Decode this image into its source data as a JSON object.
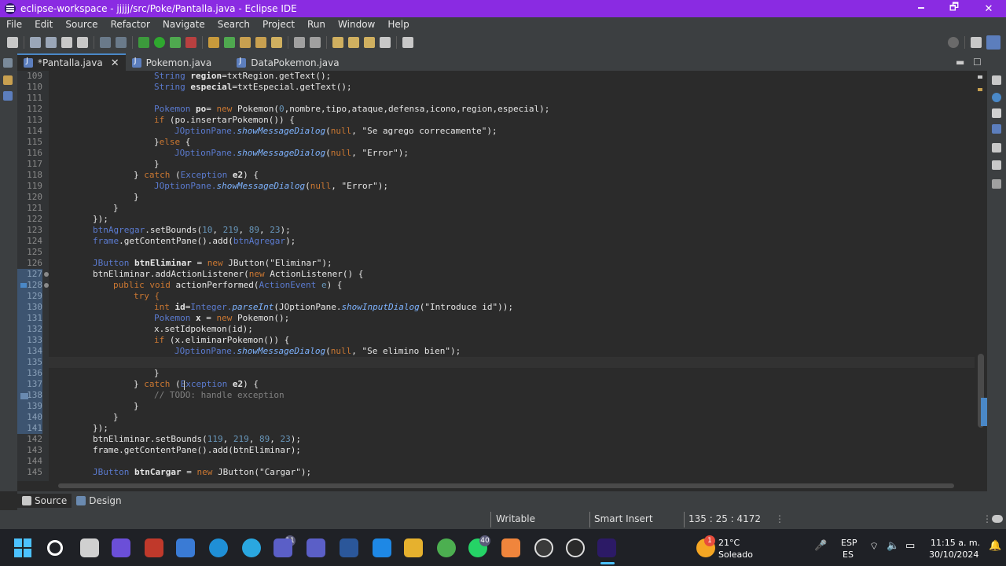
{
  "window": {
    "title": "eclipse-workspace - jjjjj/src/Poke/Pantalla.java - Eclipse IDE",
    "minimize": "🗕",
    "restore": "🗗",
    "close": "✕"
  },
  "menu": [
    "File",
    "Edit",
    "Source",
    "Refactor",
    "Navigate",
    "Search",
    "Project",
    "Run",
    "Window",
    "Help"
  ],
  "tabs": [
    {
      "label": "*Pantalla.java",
      "active": true
    },
    {
      "label": "Pokemon.java",
      "active": false
    },
    {
      "label": "DataPokemon.java",
      "active": false
    }
  ],
  "editor": {
    "lines": [
      {
        "n": "109",
        "sel": false
      },
      {
        "n": "110",
        "sel": false
      },
      {
        "n": "111",
        "sel": false
      },
      {
        "n": "112",
        "sel": false
      },
      {
        "n": "113",
        "sel": false
      },
      {
        "n": "114",
        "sel": false
      },
      {
        "n": "115",
        "sel": false
      },
      {
        "n": "116",
        "sel": false
      },
      {
        "n": "117",
        "sel": false
      },
      {
        "n": "118",
        "sel": false
      },
      {
        "n": "119",
        "sel": false
      },
      {
        "n": "120",
        "sel": false
      },
      {
        "n": "121",
        "sel": false
      },
      {
        "n": "122",
        "sel": false
      },
      {
        "n": "123",
        "sel": false
      },
      {
        "n": "124",
        "sel": false
      },
      {
        "n": "125",
        "sel": false
      },
      {
        "n": "126",
        "sel": false
      },
      {
        "n": "127",
        "sel": true
      },
      {
        "n": "128",
        "sel": true
      },
      {
        "n": "129",
        "sel": true
      },
      {
        "n": "130",
        "sel": true
      },
      {
        "n": "131",
        "sel": true
      },
      {
        "n": "132",
        "sel": true
      },
      {
        "n": "133",
        "sel": true
      },
      {
        "n": "134",
        "sel": true
      },
      {
        "n": "135",
        "sel": true
      },
      {
        "n": "136",
        "sel": true
      },
      {
        "n": "137",
        "sel": true
      },
      {
        "n": "138",
        "sel": true
      },
      {
        "n": "139",
        "sel": true
      },
      {
        "n": "140",
        "sel": true
      },
      {
        "n": "141",
        "sel": true
      },
      {
        "n": "142",
        "sel": false
      },
      {
        "n": "143",
        "sel": false
      },
      {
        "n": "144",
        "sel": false
      },
      {
        "n": "145",
        "sel": false
      }
    ],
    "code": {
      "l109a": "String ",
      "l109b": "region",
      "l109c": "=txtRegion.getText();",
      "l110a": "String ",
      "l110b": "especial",
      "l110c": "=txtEspecial.getText();",
      "l112a": "Pokemon ",
      "l112b": "po",
      "l112c": "= ",
      "l112d": "new ",
      "l112e": "Pokemon(",
      "l112f": "0",
      "l112g": ",nombre,tipo,ataque,defensa,icono,region,especial);",
      "l113a": "if ",
      "l113b": "(po.insertarPokemon()) {",
      "l114a": "JOptionPane.",
      "l114b": "showMessageDialog",
      "l114c": "(",
      "l114d": "null",
      "l114e": ", \"Se agrego correcamente\");",
      "l115a": "}",
      "l115b": "else ",
      "l115c": "{",
      "l116a": "JOptionPane.",
      "l116b": "showMessageDialog",
      "l116c": "(",
      "l116d": "null",
      "l116e": ", \"Error\");",
      "l117": "}",
      "l118a": "} ",
      "l118b": "catch ",
      "l118c": "(",
      "l118d": "Exception ",
      "l118e": "e2",
      "l118f": ") {",
      "l119a": "JOptionPane.",
      "l119b": "showMessageDialog",
      "l119c": "(",
      "l119d": "null",
      "l119e": ", \"Error\");",
      "l120": "}",
      "l121": "}",
      "l122": "});",
      "l123a": "btnAgregar",
      "l123b": ".setBounds(",
      "l123c": "10",
      "l123d": ", ",
      "l123e": "219",
      "l123f": ", ",
      "l123g": "89",
      "l123h": ", ",
      "l123i": "23",
      "l123j": ");",
      "l124a": "frame",
      "l124b": ".getContentPane().add(",
      "l124c": "btnAgregar",
      "l124d": ");",
      "l126a": "JButton ",
      "l126b": "btnEliminar",
      "l126c": " = ",
      "l126d": "new ",
      "l126e": "JButton(\"Eliminar\");",
      "l127a": "btnEliminar",
      "l127b": ".addActionListener(",
      "l127c": "new ",
      "l127d": "ActionListener() {",
      "l128a": "public ",
      "l128b": "void ",
      "l128c": "actionPerformed(",
      "l128d": "ActionEvent ",
      "l128e": "e",
      "l128f": ") {",
      "l129": "try {",
      "l130a": "int ",
      "l130b": "id",
      "l130c": "=",
      "l130d": "Integer.",
      "l130e": "parseInt",
      "l130f": "(JOptionPane.",
      "l130g": "showInputDialog",
      "l130h": "(\"Introduce id\"));",
      "l131a": "Pokemon ",
      "l131b": "x",
      "l131c": " = ",
      "l131d": "new ",
      "l131e": "Pokemon();",
      "l132": "x.setIdpokemon(id);",
      "l133a": "if ",
      "l133b": "(x.eliminarPokemon()) {",
      "l134a": "JOptionPane.",
      "l134b": "showMessageDialog",
      "l134c": "(",
      "l134d": "null",
      "l134e": ", \"Se elimino bien\");",
      "l136": "}",
      "l137a": "} ",
      "l137b": "catch ",
      "l137c": "(",
      "l137d": "Exception ",
      "l137e": "e2",
      "l137f": ") {",
      "l138": "// TODO: handle exception",
      "l139": "}",
      "l140": "}",
      "l141": "});",
      "l142a": "btnEliminar",
      "l142b": ".setBounds(",
      "l142c": "119",
      "l142d": ", ",
      "l142e": "219",
      "l142f": ", ",
      "l142g": "89",
      "l142h": ", ",
      "l142i": "23",
      "l142j": ");",
      "l143a": "frame",
      "l143b": ".getContentPane().add(",
      "l143c": "btnEliminar",
      "l143d": ");",
      "l145a": "JButton ",
      "l145b": "btnCargar",
      "l145c": " = ",
      "l145d": "new ",
      "l145e": "JButton(\"Cargar\");"
    }
  },
  "bottom_tabs": {
    "source": "Source",
    "design": "Design"
  },
  "status": {
    "writable": "Writable",
    "insert_mode": "Smart Insert",
    "position": "135 : 25 : 4172"
  },
  "taskbar": {
    "badge_teams": "11",
    "badge_whatsapp": "40",
    "weather_temp": "21°C",
    "weather_desc": "Soleado",
    "weather_badge": "1",
    "lang1": "ESP",
    "lang2": "ES",
    "time": "11:15 a. m.",
    "date": "30/10/2024"
  },
  "colors": {
    "titlebar": "#8a2be2",
    "keyword": "#cc7832",
    "type": "#5b7bd0",
    "number": "#6897bb",
    "comment": "#808080"
  }
}
